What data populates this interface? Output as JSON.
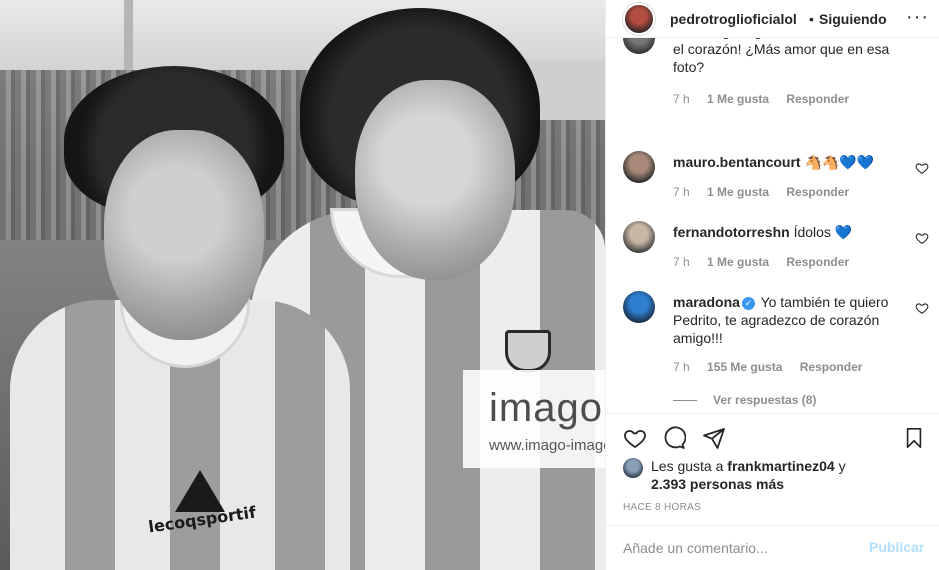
{
  "photo": {
    "watermark_brand": "imago",
    "watermark_url": "www.imago-images.de",
    "shirt_logo_text": "lecoqsportif"
  },
  "post": {
    "username": "pedrotroglioficialol",
    "separator": "•",
    "follow_status": "Siguiendo",
    "more_icon": "···"
  },
  "comments": [
    {
      "username": "",
      "text": "cardiólogo urgente!!! ¡Se me estalla el corazón! ¿Más amor que en esa foto?",
      "time": "7 h",
      "likes": "1 Me gusta",
      "reply": "Responder"
    },
    {
      "username": "mauro.bentancourt",
      "text": "🐴🐴💙💙",
      "time": "7 h",
      "likes": "1 Me gusta",
      "reply": "Responder"
    },
    {
      "username": "fernandotorreshn",
      "text": "Ídolos 💙",
      "time": "7 h",
      "likes": "1 Me gusta",
      "reply": "Responder"
    },
    {
      "username": "maradona",
      "text": "Yo también te quiero Pedrito, te agradezco de corazón amigo!!!",
      "time": "7 h",
      "likes": "155 Me gusta",
      "reply": "Responder"
    }
  ],
  "view_replies": "Ver respuestas (8)",
  "likes": {
    "prefix": "Les gusta a",
    "user": "frankmartinez04",
    "suffix": "y",
    "others": "2.393 personas más"
  },
  "posted_time": "HACE 8 HORAS",
  "add_comment": {
    "placeholder": "Añade un comentario...",
    "publish_label": "Publicar"
  },
  "colors": {
    "text": "#262626",
    "muted": "#8e8e8e",
    "verified": "#3897f0",
    "publish_disabled": "#b2dffc"
  },
  "icons": {
    "like": "heart-icon",
    "comment": "comment-icon",
    "share": "share-icon",
    "save": "bookmark-icon",
    "verified": "verified-badge-icon"
  }
}
